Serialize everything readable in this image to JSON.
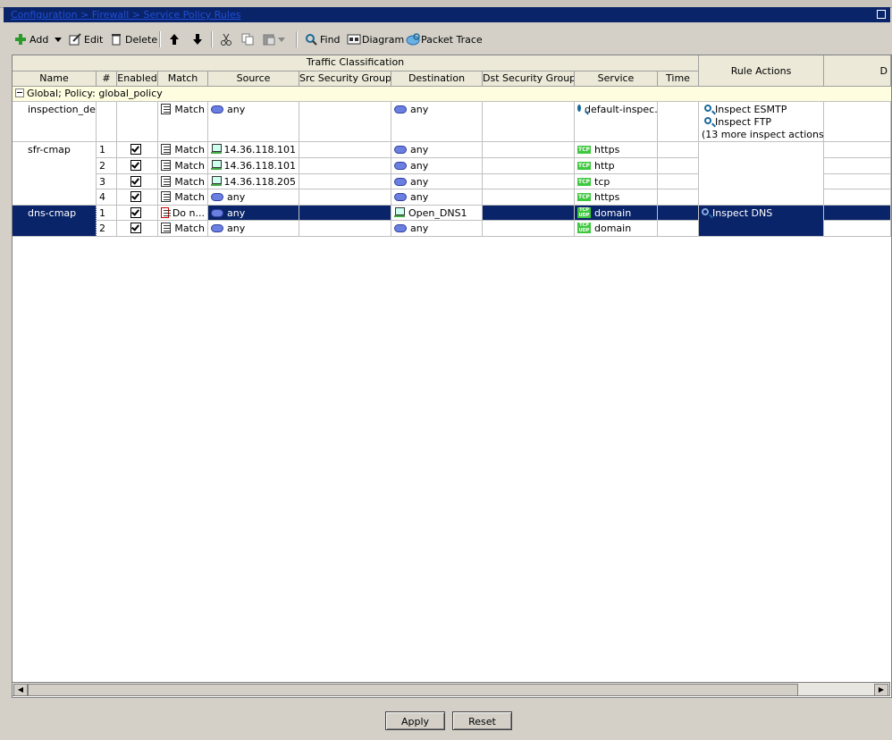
{
  "breadcrumb": "Configuration > Firewall > Service Policy Rules",
  "toolbar": {
    "add": "Add",
    "edit": "Edit",
    "delete": "Delete",
    "find": "Find",
    "diagram": "Diagram",
    "packet_trace": "Packet Trace"
  },
  "table": {
    "group_header": "Traffic Classification",
    "rule_actions_header": "Rule Actions",
    "trailing_header": "D",
    "columns": [
      "Name",
      "#",
      "Enabled",
      "Match",
      "Source",
      "Src Security Group",
      "Destination",
      "Dst Security Group",
      "Service",
      "Time"
    ],
    "group_row": "Global; Policy: global_policy",
    "rows": [
      {
        "name": "inspection_de...",
        "num": "",
        "enabled": false,
        "match": "Match",
        "source": "any",
        "src_sg": "",
        "destination": "any",
        "dst_sg": "",
        "service": "default-inspec...",
        "time": "",
        "actions": [
          "Inspect ESMTP",
          "Inspect FTP",
          "(13 more inspect actions)"
        ]
      },
      {
        "name": "sfr-cmap",
        "num": "1",
        "enabled": true,
        "match": "Match",
        "source": "14.36.118.101",
        "src_sg": "",
        "destination": "any",
        "dst_sg": "",
        "service": "https",
        "time": "",
        "actions": []
      },
      {
        "name": "",
        "num": "2",
        "enabled": true,
        "match": "Match",
        "source": "14.36.118.101",
        "src_sg": "",
        "destination": "any",
        "dst_sg": "",
        "service": "http",
        "time": "",
        "actions": []
      },
      {
        "name": "",
        "num": "3",
        "enabled": true,
        "match": "Match",
        "source": "14.36.118.205",
        "src_sg": "",
        "destination": "any",
        "dst_sg": "",
        "service": "tcp",
        "time": "",
        "actions": []
      },
      {
        "name": "",
        "num": "4",
        "enabled": true,
        "match": "Match",
        "source": "any",
        "src_sg": "",
        "destination": "any",
        "dst_sg": "",
        "service": "https",
        "time": "",
        "actions": []
      },
      {
        "name": "dns-cmap",
        "num": "1",
        "enabled": true,
        "match": "Do n...",
        "source": "any",
        "src_sg": "",
        "destination": "Open_DNS1",
        "dst_sg": "",
        "service": "domain",
        "time": "",
        "actions": [
          "Inspect DNS"
        ]
      },
      {
        "name": "",
        "num": "2",
        "enabled": true,
        "match": "Match",
        "source": "any",
        "src_sg": "",
        "destination": "any",
        "dst_sg": "",
        "service": "domain",
        "time": "",
        "actions": []
      }
    ]
  },
  "buttons": {
    "apply": "Apply",
    "reset": "Reset"
  },
  "colors": {
    "selection": "#0a246a",
    "title_bar": "#0a246a",
    "service_tag": "#3ec83e"
  }
}
